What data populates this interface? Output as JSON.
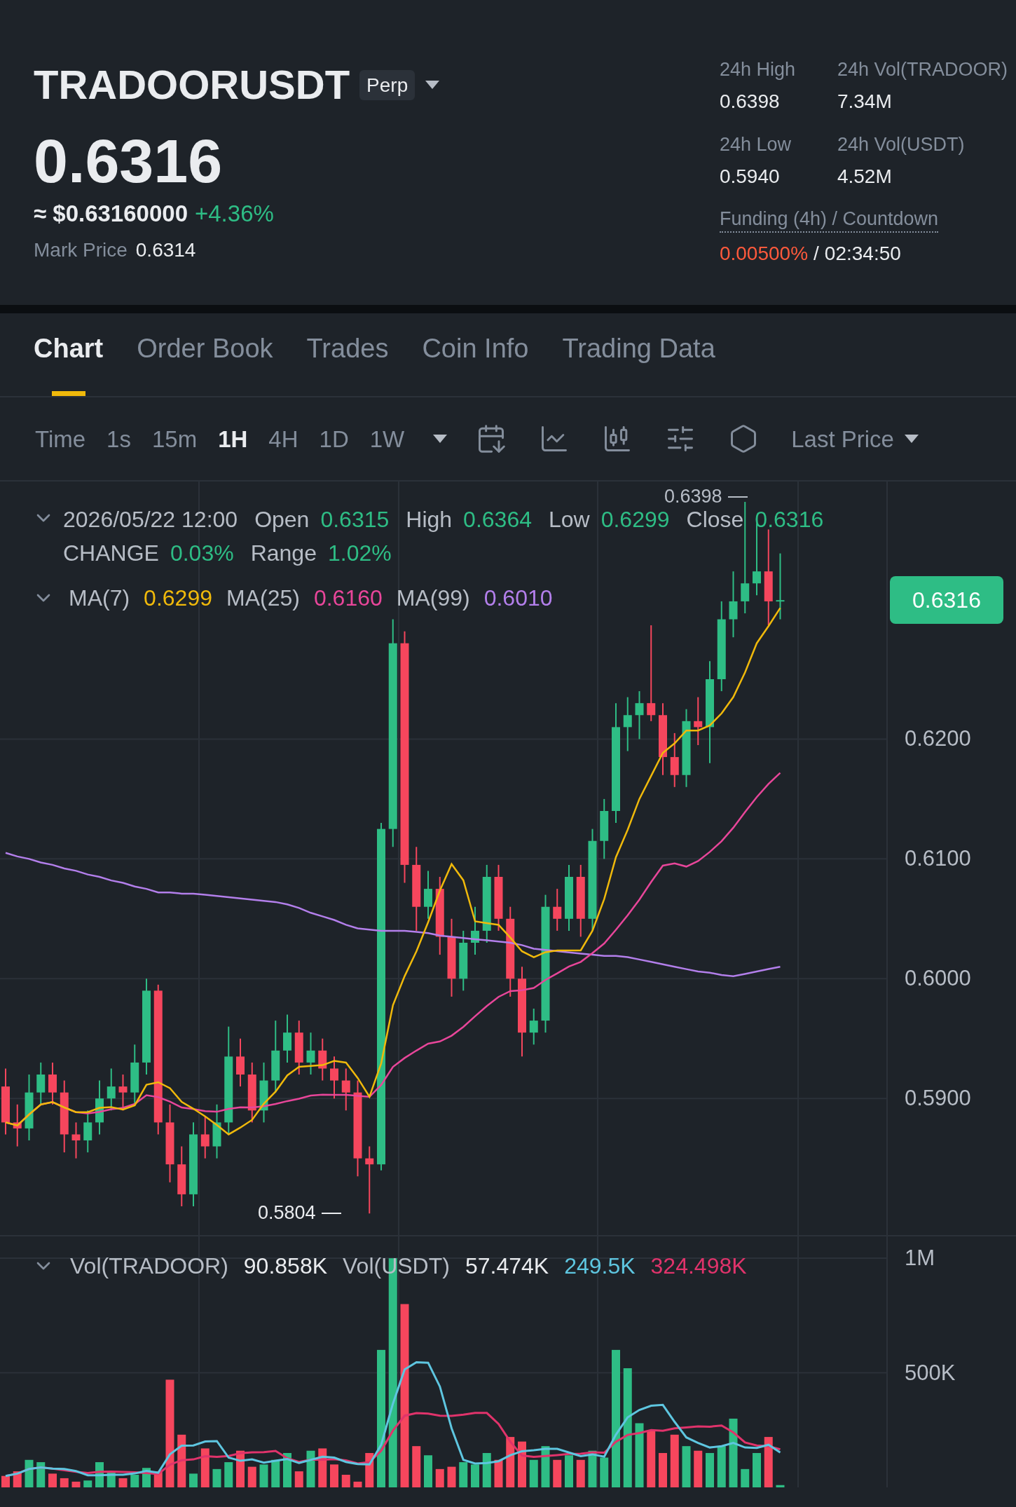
{
  "header": {
    "symbol": "TRADOORUSDT",
    "badge": "Perp",
    "last_price": "0.6316",
    "approx_usd": "≈ $0.63160000",
    "change": "+4.36%",
    "mark_price_label": "Mark Price",
    "mark_price": "0.6314",
    "stats": [
      {
        "label": "24h High",
        "value": "0.6398"
      },
      {
        "label": "24h Vol(TRADOOR)",
        "value": "7.34M"
      },
      {
        "label": "24h Low",
        "value": "0.5940"
      },
      {
        "label": "24h Vol(USDT)",
        "value": "4.52M"
      }
    ],
    "funding": {
      "label": "Funding (4h) / Countdown",
      "rate": "0.00500%",
      "separator": "/",
      "countdown": "02:34:50"
    }
  },
  "tabs": [
    {
      "label": "Chart",
      "selected": true
    },
    {
      "label": "Order Book",
      "selected": false
    },
    {
      "label": "Trades",
      "selected": false
    },
    {
      "label": "Coin Info",
      "selected": false
    },
    {
      "label": "Trading Data",
      "selected": false
    }
  ],
  "toolbar": {
    "intervals": [
      {
        "label": "Time",
        "kind": "label",
        "selected": false
      },
      {
        "label": "1s",
        "kind": "interval",
        "selected": false
      },
      {
        "label": "15m",
        "kind": "interval",
        "selected": false
      },
      {
        "label": "1H",
        "kind": "interval",
        "selected": true
      },
      {
        "label": "4H",
        "kind": "interval",
        "selected": false
      },
      {
        "label": "1D",
        "kind": "interval",
        "selected": false
      },
      {
        "label": "1W",
        "kind": "interval",
        "selected": false
      }
    ],
    "price_type": "Last Price"
  },
  "price_chart": {
    "date": "2026/05/22 12:00",
    "ohlc": [
      {
        "label": "Open",
        "value": "0.6315"
      },
      {
        "label": "High",
        "value": "0.6364"
      },
      {
        "label": "Low",
        "value": "0.6299"
      },
      {
        "label": "Close",
        "value": "0.6316"
      },
      {
        "label": "CHANGE",
        "value": "0.03%"
      },
      {
        "label": "Range",
        "value": "1.02%"
      }
    ],
    "ma_legend": [
      {
        "label": "MA(7)",
        "value": "0.6299",
        "color": "#f0b90b"
      },
      {
        "label": "MA(25)",
        "value": "0.6160",
        "color": "#e8469a"
      },
      {
        "label": "MA(99)",
        "value": "0.6010",
        "color": "#b37feb"
      }
    ],
    "high_marker": "0.6398",
    "low_marker": "0.5804",
    "current_price": "0.6316",
    "axis_labels": [
      "0.6200",
      "0.6100",
      "0.6000",
      "0.5900"
    ]
  },
  "volume_chart": {
    "legend": [
      {
        "label": "Vol(TRADOOR)",
        "value": "90.858K",
        "color": "#eaecef"
      },
      {
        "label": "Vol(USDT)",
        "value": "57.474K",
        "color": "#eaecef"
      },
      {
        "value": "249.5K",
        "color": "#5ec6e0"
      },
      {
        "value": "324.498K",
        "color": "#e0336b"
      }
    ],
    "axis_labels": [
      "1M",
      "500K"
    ]
  }
}
